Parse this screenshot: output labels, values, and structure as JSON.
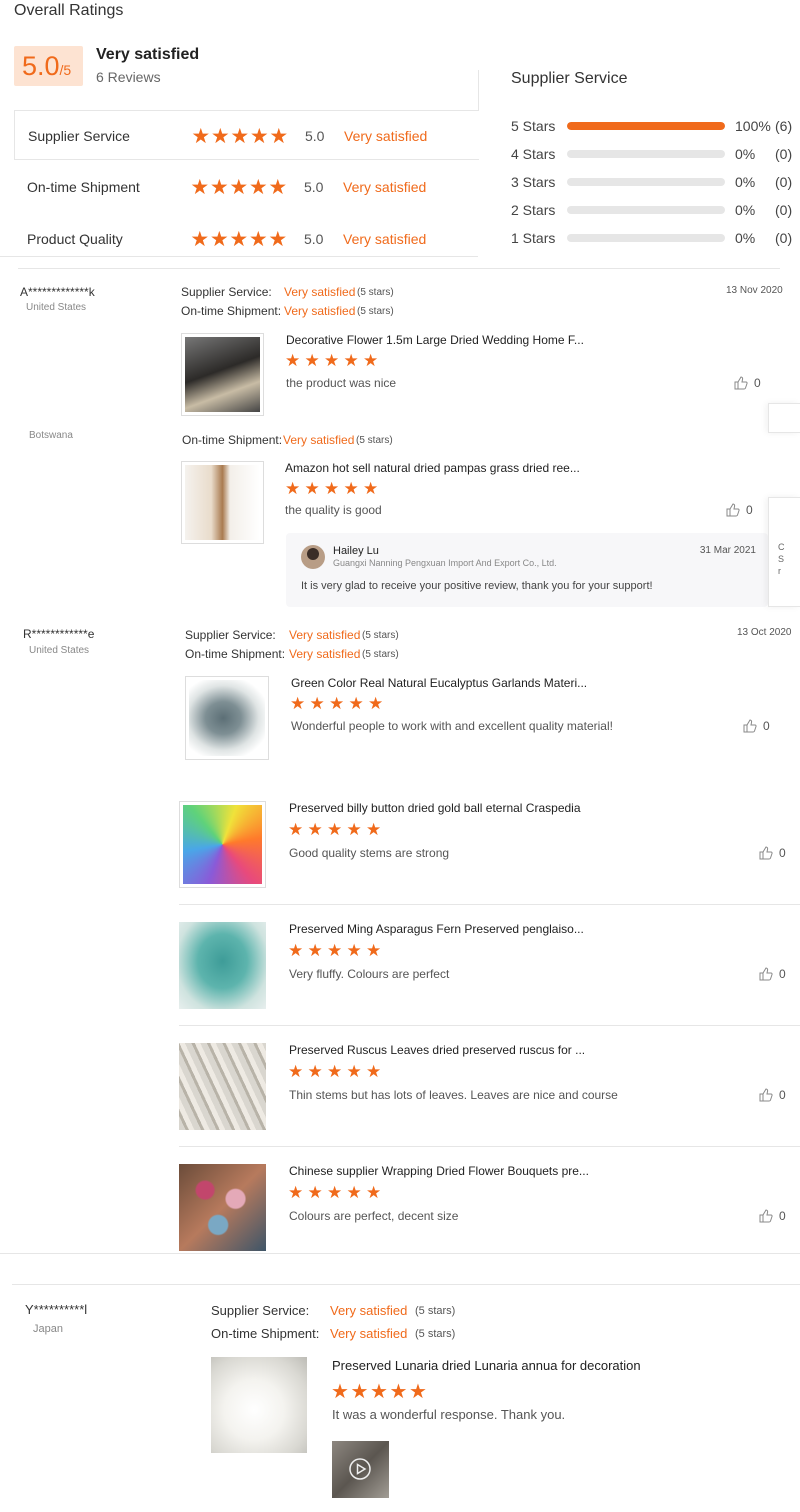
{
  "overall": {
    "title": "Overall Ratings",
    "score": "5.0",
    "score_suffix": "/5",
    "label": "Very satisfied",
    "reviews_count": "6 Reviews"
  },
  "categories": [
    {
      "name": "Supplier Service",
      "score": "5.0",
      "label": "Very satisfied",
      "stars": 5
    },
    {
      "name": "On-time Shipment",
      "score": "5.0",
      "label": "Very satisfied",
      "stars": 5
    },
    {
      "name": "Product Quality",
      "score": "5.0",
      "label": "Very satisfied",
      "stars": 5
    }
  ],
  "breakdown": {
    "title": "Supplier Service",
    "rows": [
      {
        "label": "5  Stars",
        "fraction": 1.0,
        "pct": "100%",
        "count": "(6)"
      },
      {
        "label": "4  Stars",
        "fraction": 0,
        "pct": "0%",
        "count": "(0)"
      },
      {
        "label": "3  Stars",
        "fraction": 0,
        "pct": "0%",
        "count": "(0)"
      },
      {
        "label": "2  Stars",
        "fraction": 0,
        "pct": "0%",
        "count": "(0)"
      },
      {
        "label": "1  Stars",
        "fraction": 0,
        "pct": "0%",
        "count": "(0)"
      }
    ]
  },
  "labels": {
    "supplier_service": "Supplier Service:",
    "ontime_shipment": "On-time Shipment:",
    "very_satisfied": "Very satisfied",
    "five_stars": "(5 stars)"
  },
  "reviews": [
    {
      "reviewer": "A*************k",
      "country": "United States",
      "date": "13 Nov 2020",
      "items": [
        {
          "title": "Decorative Flower 1.5m Large Dried Wedding Home F...",
          "stars": 5,
          "text": "the product was nice",
          "likes": "0"
        }
      ]
    },
    {
      "reviewer": "",
      "country": "Botswana",
      "date": "",
      "items": [
        {
          "title": "Amazon hot sell natural dried pampas grass dried ree...",
          "stars": 5,
          "text": "the quality is good",
          "likes": "0"
        }
      ],
      "reply": {
        "name": "Hailey Lu",
        "company": "Guangxi Nanning Pengxuan Import And Export Co., Ltd.",
        "date": "31 Mar 2021",
        "text": "It is very glad to receive your positive review, thank you for your support!"
      }
    },
    {
      "reviewer": "R************e",
      "country": "United States",
      "date": "13 Oct 2020",
      "items": [
        {
          "title": "Green Color Real Natural Eucalyptus Garlands Materi...",
          "stars": 5,
          "text": "Wonderful people to work with and excellent quality material!",
          "likes": "0"
        },
        {
          "title": "Preserved billy button dried gold ball eternal Craspedia",
          "stars": 5,
          "text": "Good quality stems are strong",
          "likes": "0"
        },
        {
          "title": "Preserved Ming Asparagus Fern Preserved penglaiso...",
          "stars": 5,
          "text": "Very fluffy. Colours are perfect",
          "likes": "0"
        },
        {
          "title": "Preserved Ruscus Leaves dried preserved ruscus for ...",
          "stars": 5,
          "text": "Thin stems but has lots of leaves. Leaves are nice and course",
          "likes": "0"
        },
        {
          "title": "Chinese supplier Wrapping Dried Flower Bouquets pre...",
          "stars": 5,
          "text": "Colours are perfect, decent size",
          "likes": "0"
        }
      ]
    },
    {
      "reviewer": "Y**********l",
      "country": "Japan",
      "date": "",
      "items": [
        {
          "title": "Preserved Lunaria dried Lunaria annua for decoration",
          "stars": 5,
          "text": "It was a wonderful response.  Thank you.",
          "likes": ""
        }
      ]
    }
  ],
  "side_tab": {
    "chars": [
      "C",
      "S",
      "r"
    ]
  },
  "colors": {
    "accent": "#f06a1b",
    "badge_bg": "#fde3d2",
    "track": "#e6e6e6",
    "reply_bg": "#f7f7f9"
  },
  "icons": {
    "star": "star-icon",
    "like": "thumbs-up-icon",
    "play": "play-icon"
  }
}
